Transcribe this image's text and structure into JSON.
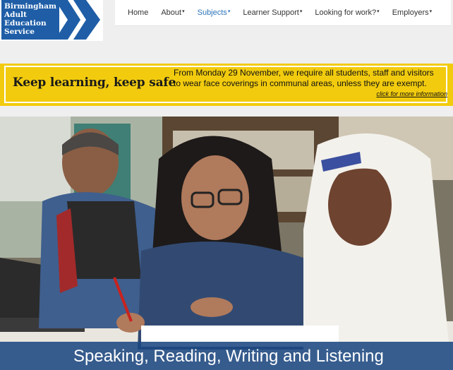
{
  "logo": {
    "lines": [
      "Birmingham",
      "Adult",
      "Education",
      "Service"
    ]
  },
  "nav": {
    "items": [
      {
        "label": "Home",
        "dropdown": false
      },
      {
        "label": "About",
        "dropdown": true
      },
      {
        "label": "Subjects",
        "dropdown": true,
        "active": true
      },
      {
        "label": "Learner Support",
        "dropdown": true
      },
      {
        "label": "Looking for work?",
        "dropdown": true
      },
      {
        "label": "Employers",
        "dropdown": true
      }
    ],
    "caret": "▾"
  },
  "banner": {
    "title": "Keep learning, keep safe",
    "message": "From Monday 29 November, we require all students, staff and visitors to wear face coverings in communal areas, unless they are exempt.",
    "link": "click for more information"
  },
  "hero": {
    "caption": "Speaking, Reading, Writing and Listening"
  },
  "colors": {
    "brand_blue": "#1f5ea7",
    "banner_yellow": "#f2cb0e",
    "nav_active": "#2a73b8"
  }
}
